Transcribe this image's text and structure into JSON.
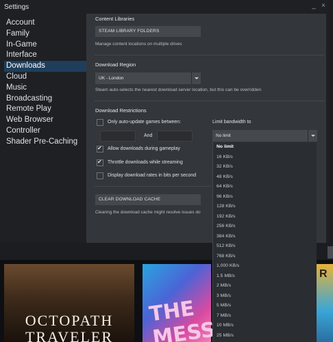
{
  "window": {
    "title": "Settings",
    "minimize_glyph": "_",
    "close_glyph": "×"
  },
  "sidebar": {
    "items": [
      {
        "label": "Account"
      },
      {
        "label": "Family"
      },
      {
        "label": "In-Game"
      },
      {
        "label": "Interface"
      },
      {
        "label": "Downloads",
        "active": true
      },
      {
        "label": "Cloud"
      },
      {
        "label": "Music"
      },
      {
        "label": "Broadcasting"
      },
      {
        "label": "Remote Play"
      },
      {
        "label": "Web Browser"
      },
      {
        "label": "Controller"
      },
      {
        "label": "Shader Pre-Caching"
      }
    ]
  },
  "content_libraries": {
    "title": "Content Libraries",
    "button": "STEAM LIBRARY FOLDERS",
    "hint": "Manage content locations on multiple drives"
  },
  "download_region": {
    "title": "Download Region",
    "selected": "UK - London",
    "hint": "Steam auto-selects the nearest download server location, but this can be overridden"
  },
  "download_restrictions": {
    "title": "Download Restrictions",
    "auto_update_label": "Only auto-update games between:",
    "and_label": "And",
    "limit_label": "Limit bandwidth to",
    "limit_selected": "No limit",
    "allow_gameplay_label": "Allow downloads during gameplay",
    "throttle_label": "Throttle downloads while streaming",
    "bits_label": "Display download rates in bits per second",
    "auto_update_checked": false,
    "allow_gameplay_checked": true,
    "throttle_checked": true,
    "bits_checked": false
  },
  "cache": {
    "button": "CLEAR DOWNLOAD CACHE",
    "hint": "Clearing the download cache might resolve issues do"
  },
  "bandwidth_options": [
    "No limit",
    "16 KB/s",
    "32 KB/s",
    "48 KB/s",
    "64 KB/s",
    "96 KB/s",
    "128 KB/s",
    "192 KB/s",
    "256 KB/s",
    "384 KB/s",
    "512 KB/s",
    "768 KB/s",
    "1,000 KB/s",
    "1.5 MB/s",
    "2 MB/s",
    "3 MB/s",
    "5 MB/s",
    "7 MB/s",
    "10 MB/s",
    "25 MB/s"
  ],
  "background": {
    "game1_title_line1": "OCTOPATH",
    "game1_title_line2": "TRAVELER",
    "game2_title": "THE MESS",
    "game3_title": "R"
  }
}
